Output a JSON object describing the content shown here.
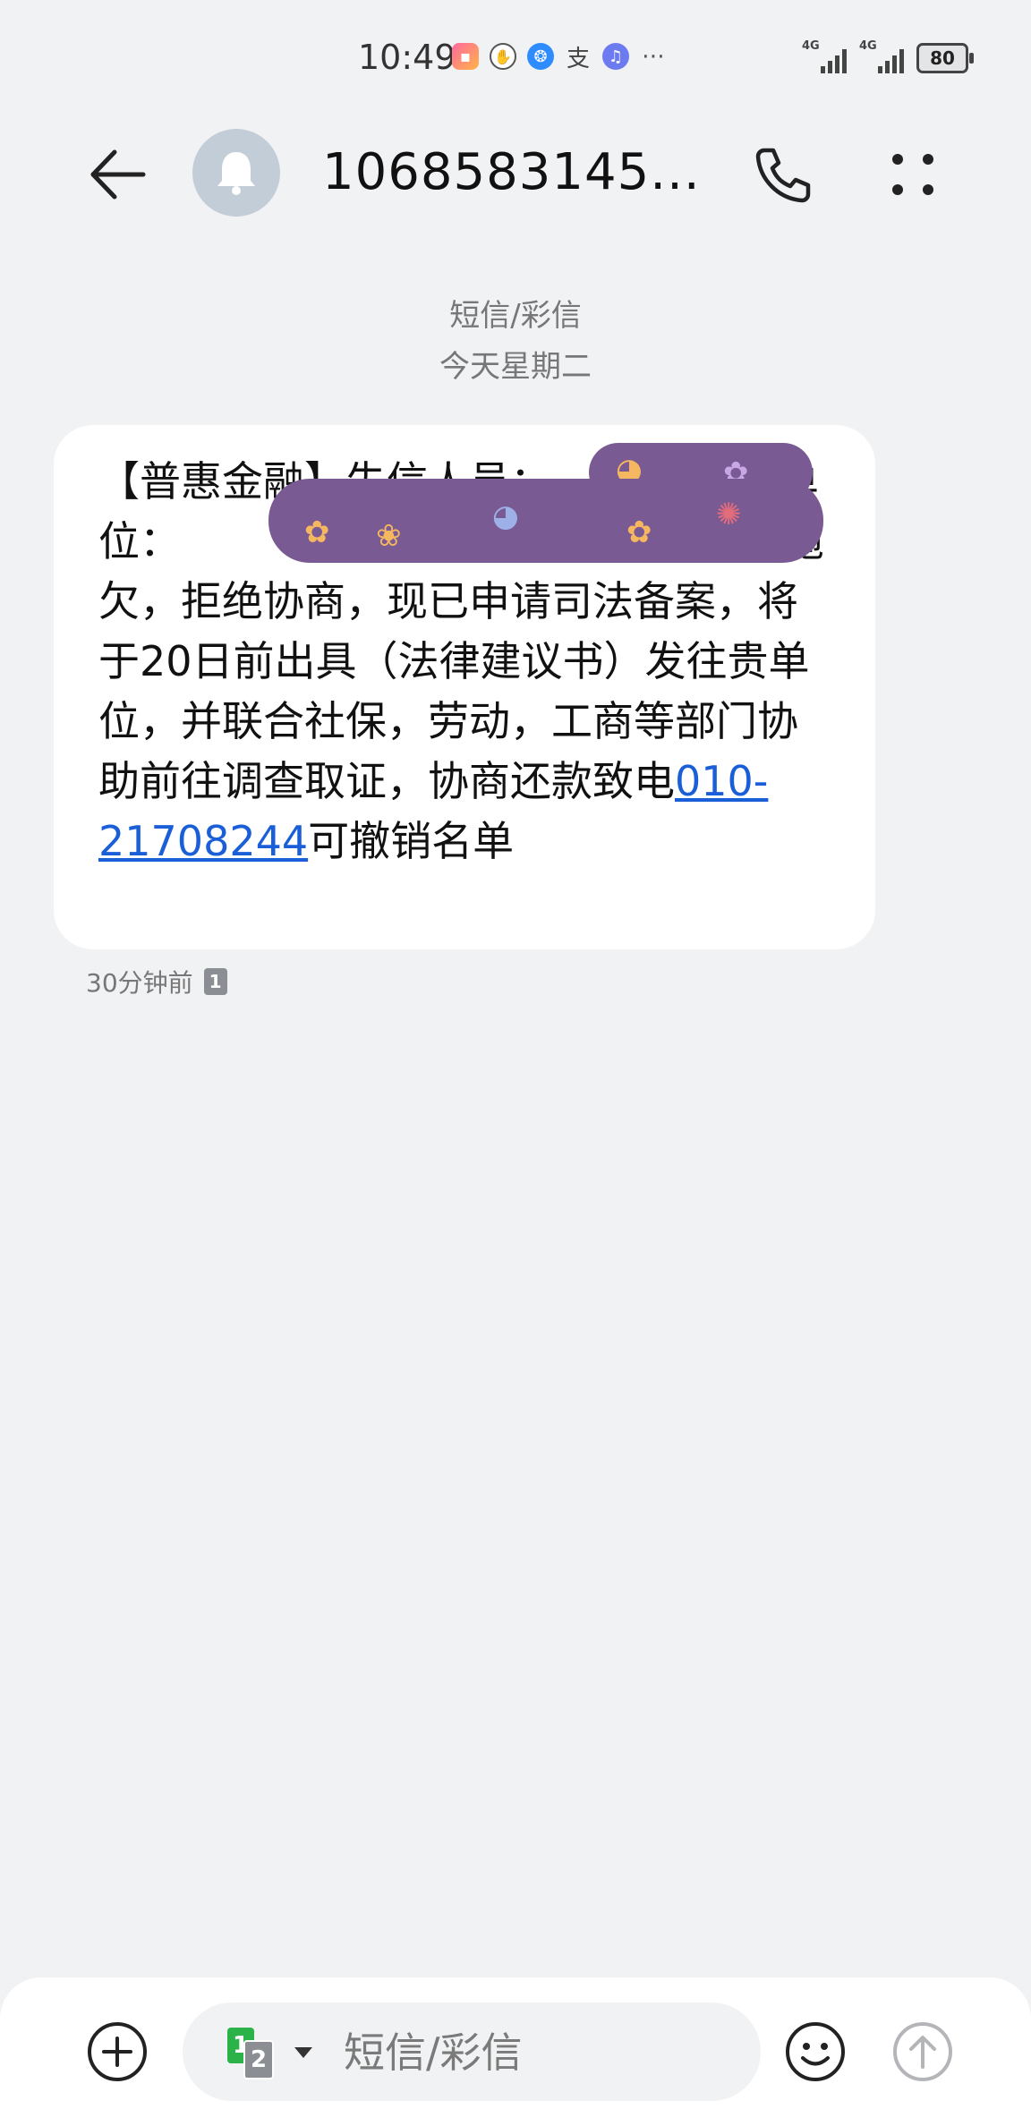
{
  "status_bar": {
    "time": "10:49",
    "network_1": "4G",
    "network_2": "4G",
    "battery": "80",
    "notification_icons": [
      "app-icon",
      "gesture-icon",
      "browser-icon",
      "alipay-icon",
      "music-icon",
      "more-dots-icon"
    ]
  },
  "header": {
    "contact_number": "1068583145..."
  },
  "thread": {
    "type_label": "短信/彩信",
    "date_label": "今天星期二"
  },
  "message": {
    "text_before_link": "【普惠金融】失信人员：           所在单位：                        司公司贷款恶意拖欠，拒绝协商，现已申请司法备案，将于20日前出具（法律建议书）发往贵单位，并联合社保，劳动，工商等部门协助前往调查取证，协商还款致电",
    "link_text": "010-21708244",
    "text_after_link": "可撤销名单",
    "time": "30分钟前",
    "sim": "1"
  },
  "composer": {
    "placeholder": "短信/彩信",
    "sim_primary": "1",
    "sim_secondary": "2"
  },
  "colors": {
    "background": "#f1f2f4",
    "bubble": "#ffffff",
    "link": "#1a5fd8",
    "redaction": "#7a5a92"
  }
}
